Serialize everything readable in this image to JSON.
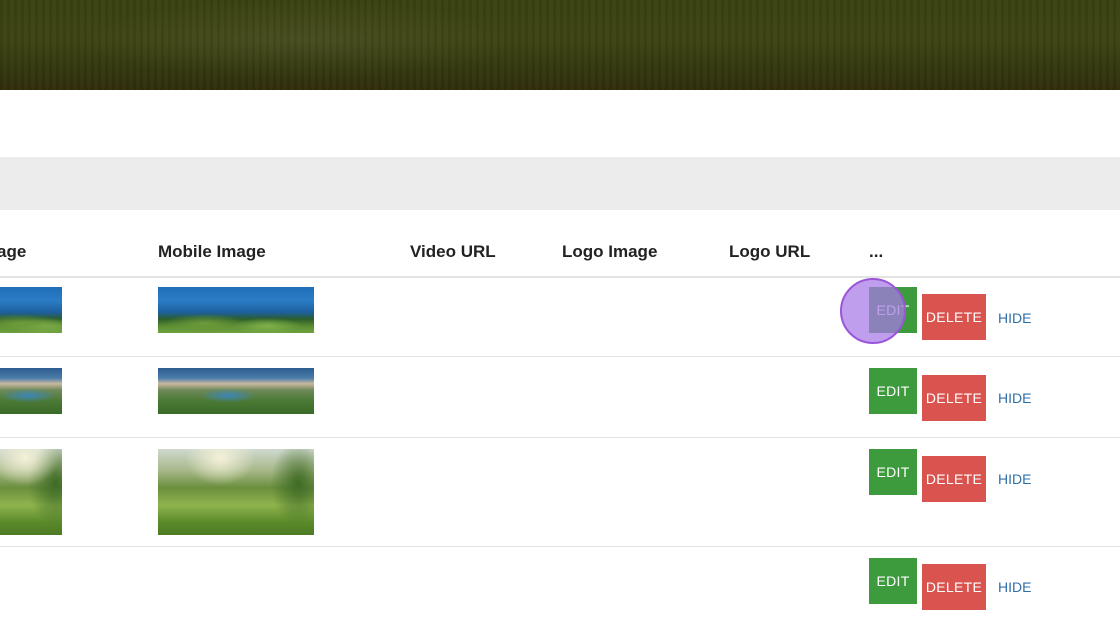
{
  "table": {
    "columns": [
      "age",
      "Mobile Image",
      "Video URL",
      "Logo Image",
      "Logo URL",
      "..."
    ],
    "rows": [
      {
        "edit": "EDIT",
        "delete": "DELETE",
        "hide": "HIDE",
        "image_theme": "sea-course"
      },
      {
        "edit": "EDIT",
        "delete": "DELETE",
        "hide": "HIDE",
        "image_theme": "resort-lake"
      },
      {
        "edit": "EDIT",
        "delete": "DELETE",
        "hide": "HIDE",
        "image_theme": "fairway-sunrise"
      },
      {
        "edit": "EDIT",
        "delete": "DELETE",
        "hide": "HIDE",
        "image_theme": "none"
      }
    ]
  },
  "colors": {
    "edit_button": "#3d9a3d",
    "delete_button": "#d9534f",
    "hide_link": "#2f6fa8",
    "cursor_highlight": "#a878e8"
  }
}
